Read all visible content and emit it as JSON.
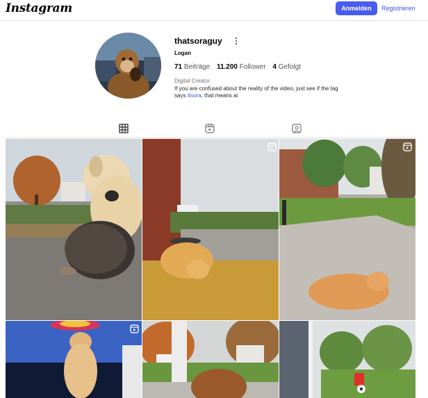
{
  "header": {
    "logo": "Instagram",
    "login_label": "Anmelden",
    "register_label": "Registrieren"
  },
  "profile": {
    "username": "thatsoraguy",
    "full_name": "Logan",
    "stats": {
      "posts_count": "71",
      "posts_label": "Beiträge",
      "followers_count": "11.200",
      "followers_label": "Follower",
      "following_count": "4",
      "following_label": "Gefolgt"
    },
    "category": "Digital Creator",
    "bio_prefix": "If you are confused about the reality of the video, just see if the tag says ",
    "bio_tag": "#sora",
    "bio_suffix": ", that means ai"
  },
  "tabs": [
    {
      "icon": "grid-icon",
      "active": true
    },
    {
      "icon": "reels-icon",
      "active": false
    },
    {
      "icon": "tagged-icon",
      "active": false
    }
  ],
  "posts": [
    {
      "subject": "dog and hedgehog at front door",
      "reel": false
    },
    {
      "subject": "puppy sleeping on welcome mat",
      "reel": true
    },
    {
      "subject": "orange cat lying on sidewalk",
      "reel": true
    },
    {
      "subject": "chihuahua with sombrero",
      "reel": true
    },
    {
      "subject": "dog on porch",
      "reel": false
    },
    {
      "subject": "kid with soccer ball in yard",
      "reel": false
    }
  ]
}
